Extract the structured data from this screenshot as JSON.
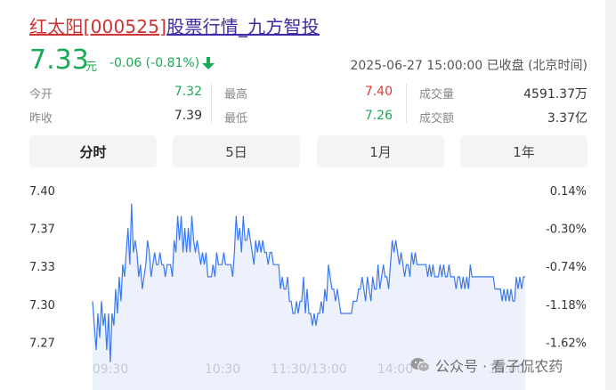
{
  "title": {
    "name_code": "红太阳[000525]",
    "rest": "股票行情_九方智投"
  },
  "quote": {
    "price": "7.33",
    "unit": "元",
    "change": "-0.06 (-0.81%)",
    "direction_icon": "arrow-down-icon",
    "timestamp": "2025-06-27 15:00:00 已收盘 (北京时间)"
  },
  "stats": {
    "open_label": "今开",
    "open_value": "7.32",
    "prev_close_label": "昨收",
    "prev_close_value": "7.39",
    "high_label": "最高",
    "high_value": "7.40",
    "low_label": "最低",
    "low_value": "7.26",
    "volume_label": "成交量",
    "volume_value": "4591.37万",
    "turnover_label": "成交额",
    "turnover_value": "3.37亿"
  },
  "tabs": [
    {
      "label": "分时",
      "active": true
    },
    {
      "label": "5日",
      "active": false
    },
    {
      "label": "1月",
      "active": false
    },
    {
      "label": "1年",
      "active": false
    }
  ],
  "watermark": {
    "icon": "wechat-icon",
    "text": "公众号 · 看子侃农药"
  },
  "colors": {
    "up": "#e03a3a",
    "down": "#1aaa55",
    "line": "#3a78f0",
    "area": "#e8eefb"
  },
  "chart_data": {
    "type": "line",
    "title": "",
    "xlabel": "",
    "ylabel": "",
    "y_tick_labels_left": [
      "7.40",
      "7.37",
      "7.33",
      "7.30",
      "7.27"
    ],
    "y_tick_labels_right": [
      "0.14%",
      "-0.30%",
      "-0.74%",
      "-1.18%",
      "-1.62%"
    ],
    "x_tick_labels": [
      "09:30",
      "10:30",
      "11:30/13:00",
      "14:00",
      "15:00"
    ],
    "ylim": [
      7.265,
      7.4
    ],
    "xlim": [
      0,
      240
    ],
    "grid": false,
    "series": [
      {
        "values": [
          7.31,
          7.29,
          7.27,
          7.3,
          7.28,
          7.31,
          7.29,
          7.3,
          7.27,
          7.3,
          7.26,
          7.3,
          7.29,
          7.32,
          7.3,
          7.33,
          7.31,
          7.34,
          7.33,
          7.35,
          7.37,
          7.34,
          7.39,
          7.35,
          7.36,
          7.35,
          7.33,
          7.34,
          7.32,
          7.33,
          7.34,
          7.36,
          7.35,
          7.33,
          7.34,
          7.35,
          7.34,
          7.34,
          7.35,
          7.34,
          7.34,
          7.33,
          7.34,
          7.34,
          7.34,
          7.33,
          7.36,
          7.35,
          7.38,
          7.36,
          7.38,
          7.35,
          7.37,
          7.35,
          7.37,
          7.35,
          7.38,
          7.36,
          7.35,
          7.36,
          7.35,
          7.34,
          7.35,
          7.34,
          7.35,
          7.33,
          7.33,
          7.33,
          7.34,
          7.33,
          7.35,
          7.34,
          7.34,
          7.34,
          7.35,
          7.34,
          7.34,
          7.34,
          7.34,
          7.33,
          7.35,
          7.38,
          7.36,
          7.37,
          7.35,
          7.38,
          7.36,
          7.36,
          7.37,
          7.36,
          7.35,
          7.34,
          7.36,
          7.35,
          7.36,
          7.35,
          7.36,
          7.35,
          7.35,
          7.34,
          7.35,
          7.35,
          7.34,
          7.34,
          7.34,
          7.34,
          7.32,
          7.33,
          7.32,
          7.32,
          7.33,
          7.31,
          7.31,
          7.3,
          7.3,
          7.31,
          7.3,
          7.31,
          7.31,
          7.33,
          7.3,
          7.32,
          7.3,
          7.3,
          7.29,
          7.3,
          7.29,
          7.3,
          7.3,
          7.31,
          7.3,
          7.32,
          7.31,
          7.34,
          7.33,
          7.32,
          7.32,
          7.31,
          7.32,
          7.31,
          7.3,
          7.3,
          7.3,
          7.3,
          7.3,
          7.3,
          7.3,
          7.31,
          7.31,
          7.31,
          7.32,
          7.32,
          7.33,
          7.32,
          7.31,
          7.33,
          7.32,
          7.31,
          7.33,
          7.32,
          7.32,
          7.34,
          7.32,
          7.33,
          7.34,
          7.33,
          7.33,
          7.32,
          7.34,
          7.36,
          7.35,
          7.36,
          7.35,
          7.34,
          7.35,
          7.34,
          7.33,
          7.34,
          7.34,
          7.33,
          7.35,
          7.34,
          7.35,
          7.34,
          7.34,
          7.34,
          7.34,
          7.34,
          7.34,
          7.33,
          7.34,
          7.33,
          7.34,
          7.33,
          7.33,
          7.33,
          7.34,
          7.33,
          7.34,
          7.33,
          7.33,
          7.34,
          7.33,
          7.33,
          7.33,
          7.32,
          7.33,
          7.33,
          7.32,
          7.33,
          7.32,
          7.33,
          7.32,
          7.34,
          7.33,
          7.33,
          7.33,
          7.33,
          7.33,
          7.33,
          7.33,
          7.33,
          7.33,
          7.33,
          7.33,
          7.33,
          7.33,
          7.32,
          7.32,
          7.32,
          7.32,
          7.31,
          7.32,
          7.31,
          7.32,
          7.31,
          7.32,
          7.31,
          7.31,
          7.33,
          7.32,
          7.33,
          7.32,
          7.33,
          7.33
        ]
      }
    ]
  }
}
